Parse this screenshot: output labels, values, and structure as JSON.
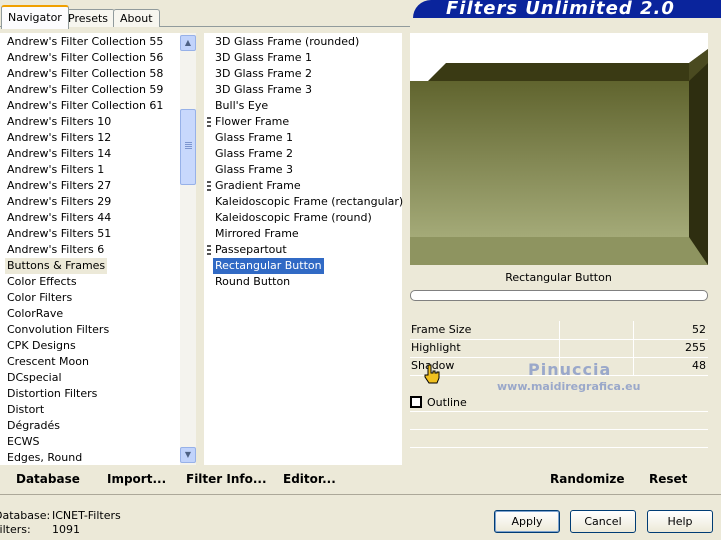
{
  "header": {
    "title": "Filters Unlimited 2.0"
  },
  "tabs": [
    {
      "label": "Navigator",
      "active": true
    },
    {
      "label": "Presets",
      "active": false
    },
    {
      "label": "About",
      "active": false
    }
  ],
  "categories": {
    "items": [
      "Andrew's Filter Collection 55",
      "Andrew's Filter Collection 56",
      "Andrew's Filter Collection 58",
      "Andrew's Filter Collection 59",
      "Andrew's Filter Collection 61",
      "Andrew's Filters 10",
      "Andrew's Filters 12",
      "Andrew's Filters 14",
      "Andrew's Filters 1",
      "Andrew's Filters 27",
      "Andrew's Filters 29",
      "Andrew's Filters 44",
      "Andrew's Filters 51",
      "Andrew's Filters 6",
      "Buttons & Frames",
      "Color Effects",
      "Color Filters",
      "ColorRave",
      "Convolution Filters",
      "CPK Designs",
      "Crescent Moon",
      "DCspecial",
      "Distortion Filters",
      "Distort",
      "Dégradés",
      "ECWS",
      "Edges, Round"
    ],
    "selected": "Buttons & Frames"
  },
  "filters": {
    "items": [
      "3D Glass Frame (rounded)",
      "3D Glass Frame 1",
      "3D Glass Frame 2",
      "3D Glass Frame 3",
      "Bull's Eye",
      "Flower Frame",
      "Glass Frame 1",
      "Glass Frame 2",
      "Glass Frame 3",
      "Gradient Frame",
      "Kaleidoscopic Frame (rectangular)",
      "Kaleidoscopic Frame (round)",
      "Mirrored Frame",
      "Passepartout",
      "Rectangular Button",
      "Round Button"
    ],
    "grouped": [
      "Flower Frame",
      "Gradient Frame",
      "Passepartout"
    ],
    "selected": "Rectangular Button"
  },
  "preview": {
    "filter_name": "Rectangular Button"
  },
  "params": [
    {
      "name": "Frame Size",
      "value": "52"
    },
    {
      "name": "Highlight",
      "value": "255"
    },
    {
      "name": "Shadow",
      "value": "48"
    }
  ],
  "outline": {
    "label": "Outline",
    "checked": false
  },
  "watermark": {
    "name": "Pinuccia",
    "url": "www.maidiregrafica.eu"
  },
  "buttons": {
    "database": "Database",
    "import": "Import...",
    "filter_info": "Filter Info...",
    "editor": "Editor...",
    "randomize": "Randomize",
    "reset": "Reset",
    "apply": "Apply",
    "cancel": "Cancel",
    "help": "Help"
  },
  "status": {
    "database_label": "Database:",
    "database_value": "ICNET-Filters",
    "filters_label": "Filters:",
    "filters_value": "1091"
  },
  "colors": {
    "frame_light": "#dcdcb8",
    "frame_mid": "#8e9460",
    "frame_dark": "#3a3a14",
    "accent": "#0a249c"
  }
}
